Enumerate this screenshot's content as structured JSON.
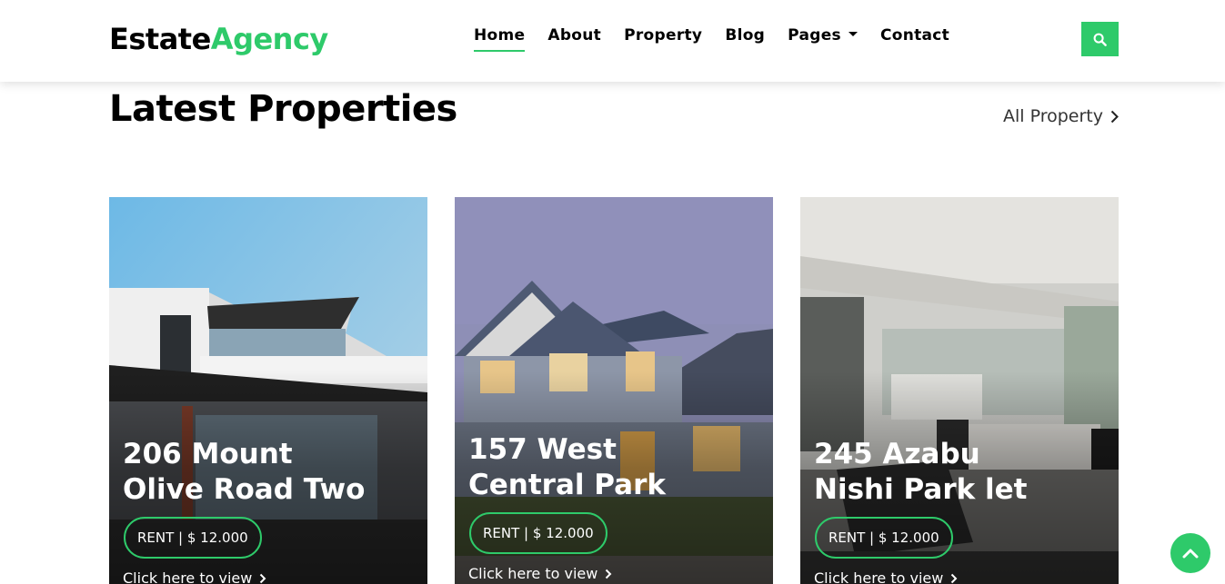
{
  "brand": {
    "part1": "Estate",
    "part2": "Agency"
  },
  "nav": {
    "items": [
      {
        "label": "Home"
      },
      {
        "label": "About"
      },
      {
        "label": "Property"
      },
      {
        "label": "Blog"
      },
      {
        "label": "Pages"
      },
      {
        "label": "Contact"
      }
    ],
    "search_icon": "search-icon"
  },
  "section": {
    "title": "Latest Properties",
    "all_link": "All Property"
  },
  "cards": [
    {
      "title_line1": "206 Mount",
      "title_line2": "Olive Road Two",
      "price": "RENT | $ 12.000",
      "link": "Click here to view"
    },
    {
      "title_line1": "157 West",
      "title_line2": "Central Park",
      "price": "RENT | $ 12.000",
      "link": "Click here to view"
    },
    {
      "title_line1": "245 Azabu",
      "title_line2": "Nishi Park let",
      "price": "RENT | $ 12.000",
      "link": "Click here to view"
    }
  ],
  "colors": {
    "accent": "#2eca6a",
    "text": "#000000"
  },
  "back_to_top_icon": "chevron-up-icon"
}
